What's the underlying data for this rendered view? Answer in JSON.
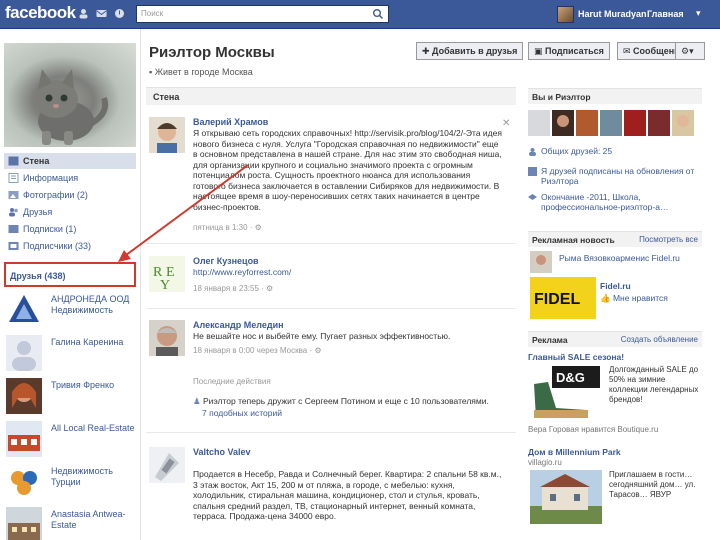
{
  "topbar": {
    "logo": "facebook",
    "search_placeholder": "Поиск",
    "user_name": "Harut Muradyan",
    "home_label": "Главная",
    "account_label": "▾"
  },
  "profile": {
    "name": "Риэлтор Москвы",
    "subtitle": "Живет в городе Москва",
    "buttons": {
      "add_friend": "Добавить в друзья",
      "subscribe": "Подписаться",
      "message": "Сообщение"
    }
  },
  "left_nav": [
    {
      "label": "Стена",
      "icon": "wall-icon"
    },
    {
      "label": "Информация",
      "icon": "info-icon"
    },
    {
      "label": "Фотографии (2)",
      "icon": "photos-icon"
    },
    {
      "label": "Друзья",
      "icon": "friends-icon"
    },
    {
      "label": "Подписки (1)",
      "icon": "subscriptions-icon"
    },
    {
      "label": "Подписчики (33)",
      "icon": "subscribers-icon"
    }
  ],
  "friends": {
    "header": "Друзья (438)",
    "items": [
      {
        "name": "АНДРОНЕДА ООД Недвижимость"
      },
      {
        "name": "Галина Каренина"
      },
      {
        "name": "Тривия Френко"
      },
      {
        "name": "All Local Real-Estate"
      },
      {
        "name": "Недвижимость Турции"
      },
      {
        "name": "Anastasia Antwea-Estate"
      }
    ]
  },
  "wall": {
    "header": "Стена",
    "stories": [
      {
        "author": "Валерий Храмов",
        "text": "Я открываю сеть городских справочных! http://servisik.pro/blog/104/2/-Эта идея нового бизнеса с нуля. Услуга \"Городская справочная по недвижимости\" еще в основном представлена в нашей стране. Для нас этим это свободная ниша, для организации крупного и социально значимого проекта с огромным потенциалом роста. Сущность проектного нюанса для использования готового бизнеса заключается в оставлении Сибиряков для недвижимости. В настоящее время в шоу-переносивших сетях таких начинается в центре бизнес-проектов.",
        "meta": "пятница в 1:30 · ⚙"
      },
      {
        "author": "Олег Кузнецов",
        "text": "http://www.reyforrest.com/",
        "meta": "18 января в 23:55 · ⚙"
      },
      {
        "author": "Александр Меледин",
        "text": "Не вешайте нос и выбейте ему. Пугает разных эффективностью.",
        "meta": "18 января в 0:00 через Москва · ⚙"
      }
    ],
    "recent_label": "Последние действия",
    "recent_text": "Риэлтор теперь дружит с Сергеем Потином и еще с 10 пользователями.",
    "recent_more": "7 подобных историй",
    "last_story": {
      "author": "Valtcho Valev",
      "text": "Продается в Несебр, Равда и Солнечный берег. Квартира: 2 спальни 58 кв.м., 3 этаж восток, Акт 15, 200 м от пляжа, в городе, с мебелью: кухня, холодильник, стиральная машина, кондиционер, стол и стулья, кровать, спальня средний раздел, ТВ, стационарный интернет, венный комната, терраса. Продажа-цена 34000 евро."
    }
  },
  "right": {
    "you_and": "Вы и Риэлтор",
    "common_friends": "Общих друзей: 25",
    "row2": "Я друзей подписаны на обновления от Риэлтора",
    "row3": "Окончание -2011, Школа, профессиональное-риэлтор-а…",
    "ad_section": "Рекламная новость",
    "ad_more": "Посмотреть все",
    "ad_line": "Рыма Вязовкоарменис Fidel.ru",
    "ad_brand": "Fidel.ru",
    "ad_like": "Мне нравится",
    "ads_header": "Реклама",
    "ads_create": "Создать объявление",
    "ad1_title": "Главный SALE сезона!",
    "ad1_text": "Долгожданный SALE до 50% на зимние коллекции легендарных брендов!",
    "ad1_foot": "Вера Горовая нравится Boutique.ru",
    "ad2_title": "Дом в Millennium Park",
    "ad2_site": "villagio.ru",
    "ad2_text": "Приглашаем в гости… сегодняшний дом… ул. Тарасов… ЯВУР"
  },
  "colors": {
    "topbar": "#3b5998",
    "link": "#3b5998",
    "annotation": "#d0392b"
  }
}
